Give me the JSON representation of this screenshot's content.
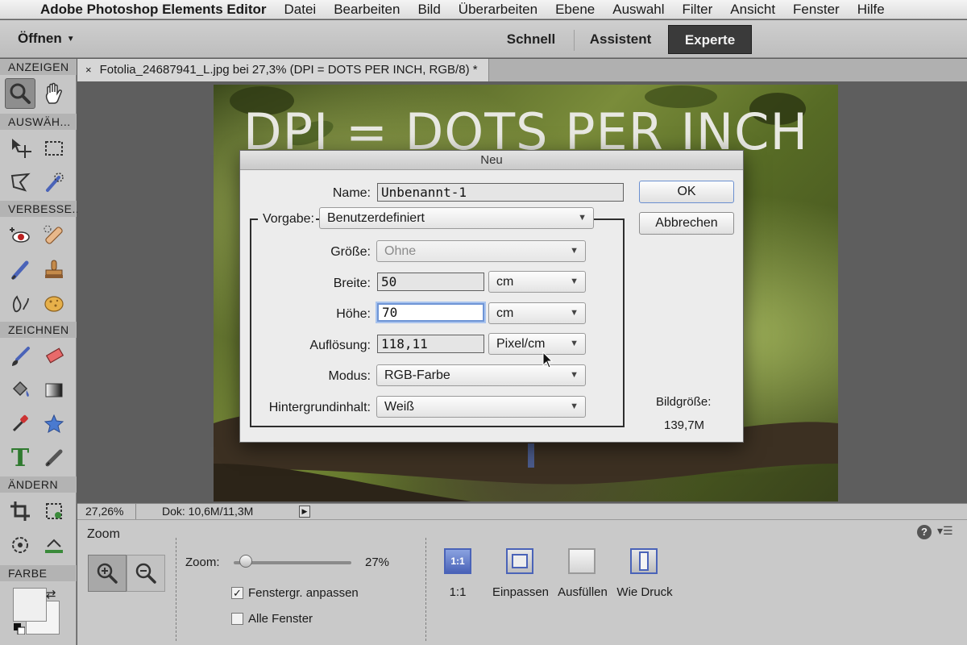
{
  "menubar": {
    "app_name": "Adobe Photoshop Elements Editor",
    "items": [
      "Datei",
      "Bearbeiten",
      "Bild",
      "Überarbeiten",
      "Ebene",
      "Auswahl",
      "Filter",
      "Ansicht",
      "Fenster",
      "Hilfe"
    ]
  },
  "topbar": {
    "open_label": "Öffnen",
    "modes": {
      "schnell": "Schnell",
      "assistent": "Assistent",
      "experte": "Experte"
    },
    "active_mode": "Experte"
  },
  "toolbox": {
    "sections": {
      "anzeigen": "ANZEIGEN",
      "auswahl": "AUSWÄH...",
      "verbessern": "VERBESSE...",
      "zeichnen": "ZEICHNEN",
      "aendern": "ÄNDERN",
      "farbe": "FARBE"
    },
    "icons": {
      "zoom": "zoom-tool-icon",
      "hand": "hand-tool-icon",
      "move": "move-tool-icon",
      "marquee": "marquee-tool-icon",
      "lasso": "lasso-tool-icon",
      "quick_select": "quick-selection-icon",
      "redeye": "red-eye-icon",
      "spot_heal": "spot-healing-icon",
      "smart_brush": "smart-brush-icon",
      "stamp": "clone-stamp-icon",
      "blur": "blur-tool-icon",
      "sponge": "sponge-tool-icon",
      "brush": "brush-tool-icon",
      "eraser": "eraser-tool-icon",
      "bucket": "paint-bucket-icon",
      "gradient": "gradient-tool-icon",
      "eyedropper": "eyedropper-icon",
      "shape": "custom-shape-icon",
      "text": "text-tool-icon",
      "pencil": "pencil-tool-icon",
      "crop": "crop-tool-icon",
      "recompose": "recompose-tool-icon",
      "content_move": "content-aware-move-icon",
      "straighten": "straighten-tool-icon"
    },
    "text_tool_glyph": "T"
  },
  "document": {
    "tab_title": "Fotolia_24687941_L.jpg bei 27,3% (DPI = DOTS PER INCH, RGB/8) *",
    "close_glyph": "×",
    "photo_text": "DPI = DOTS PER INCH"
  },
  "status": {
    "zoom": "27,26%",
    "doc": "Dok: 10,6M/11,3M",
    "arrow": "▶"
  },
  "tool_options": {
    "title": "Zoom",
    "help": "?",
    "zoom_label": "Zoom:",
    "zoom_value": "27%",
    "zoom_fraction": 0.05,
    "fit_window_label": "Fenstergr. anpassen",
    "fit_window_checked": true,
    "all_windows_label": "Alle Fenster",
    "all_windows_checked": false,
    "check_glyph": "✓",
    "view_buttons": [
      {
        "label": "1:1",
        "icon_text": "1:1"
      },
      {
        "label": "Einpassen"
      },
      {
        "label": "Ausfüllen"
      },
      {
        "label": "Wie Druck"
      }
    ]
  },
  "dialog": {
    "title": "Neu",
    "name_label": "Name:",
    "name_value": "Unbenannt-1",
    "preset_label": "Vorgabe:",
    "preset_value": "Benutzerdefiniert",
    "size_label": "Größe:",
    "size_value": "Ohne",
    "width_label": "Breite:",
    "width_value": "50",
    "width_unit": "cm",
    "height_label": "Höhe:",
    "height_value": "70",
    "height_unit": "cm",
    "resolution_label": "Auflösung:",
    "resolution_value": "118,11",
    "resolution_unit": "Pixel/cm",
    "mode_label": "Modus:",
    "mode_value": "RGB-Farbe",
    "background_label": "Hintergrundinhalt:",
    "background_value": "Weiß",
    "ok_label": "OK",
    "cancel_label": "Abbrechen",
    "image_size_label": "Bildgröße:",
    "image_size_value": "139,7M"
  },
  "colors": {
    "accent_blue": "#4a63b8",
    "active_mode_bg": "#3a3a3a",
    "focus_ring": "#6f95d6"
  }
}
